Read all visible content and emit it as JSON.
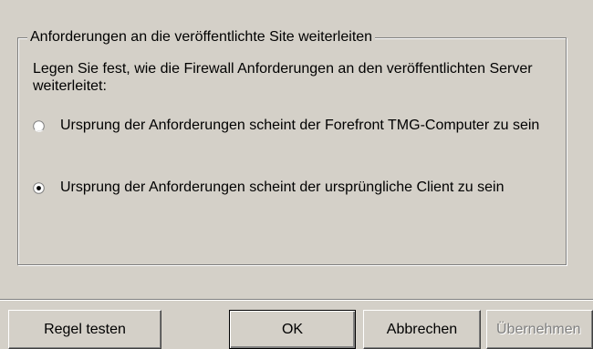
{
  "group": {
    "title": "Anforderungen an die veröffentlichte Site weiterleiten",
    "description": "Legen Sie fest, wie die Firewall Anforderungen an den veröffentlichten Server weiterleitet:"
  },
  "options": [
    {
      "label": "Ursprung der Anforderungen scheint der Forefront TMG-Computer zu sein",
      "selected": false
    },
    {
      "label": "Ursprung der Anforderungen scheint der ursprüngliche Client zu sein",
      "selected": true
    }
  ],
  "buttons": {
    "test_rule": "Regel testen",
    "ok": "OK",
    "cancel": "Abbrechen",
    "apply": "Übernehmen"
  }
}
